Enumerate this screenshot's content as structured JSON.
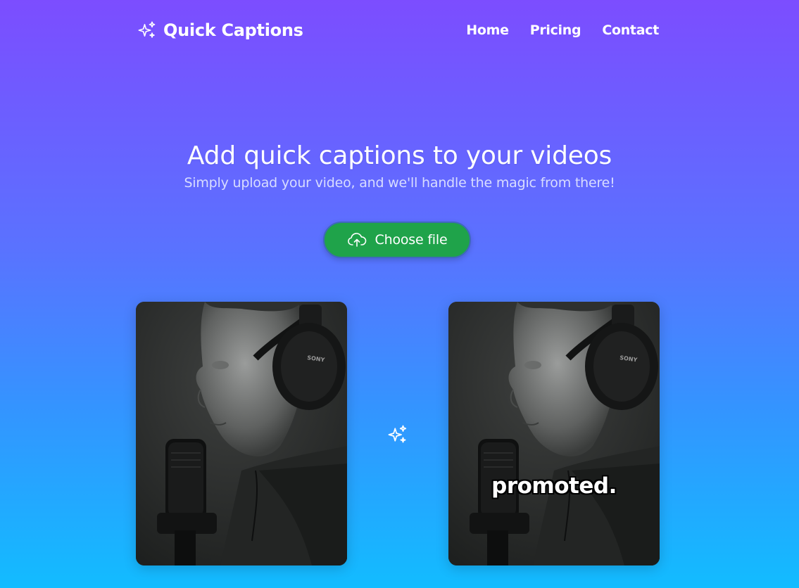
{
  "header": {
    "brand": "Quick Captions",
    "brand_icon": "sparkles-icon",
    "nav": [
      {
        "label": "Home"
      },
      {
        "label": "Pricing"
      },
      {
        "label": "Contact"
      }
    ]
  },
  "hero": {
    "title": "Add quick captions to your videos",
    "subtitle": "Simply upload your video, and we'll handle the magic from there!"
  },
  "upload": {
    "label": "Choose file",
    "icon": "cloud-upload-icon"
  },
  "preview": {
    "caption_text": "promoted.",
    "between_icon": "sparkles-icon"
  },
  "colors": {
    "gradient_top": "#7c4dff",
    "gradient_bottom": "#12bcff",
    "button": "#1fa34a"
  }
}
